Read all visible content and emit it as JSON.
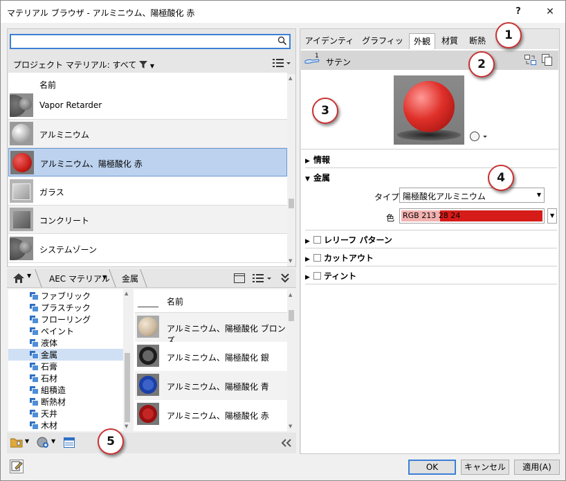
{
  "window": {
    "title": "マテリアル ブラウザ - アルミニウム、陽極酸化 赤",
    "help_label": "?",
    "close_label": "✕"
  },
  "search": {
    "value": "",
    "placeholder": ""
  },
  "project_filter": {
    "label": "プロジェクト マテリアル: すべて"
  },
  "project_list": {
    "header": "名前",
    "items": [
      {
        "label": "Vapor Retarder"
      },
      {
        "label": "アルミニウム"
      },
      {
        "label": "アルミニウム、陽極酸化 赤"
      },
      {
        "label": "ガラス"
      },
      {
        "label": "コンクリート"
      },
      {
        "label": "システムゾーン"
      }
    ]
  },
  "breadcrumb": {
    "items": [
      {
        "label": "AEC マテリアル"
      },
      {
        "label": "金属"
      }
    ]
  },
  "library_tree": {
    "items": [
      {
        "label": "ファブリック"
      },
      {
        "label": "プラスチック"
      },
      {
        "label": "フローリング"
      },
      {
        "label": "ペイント"
      },
      {
        "label": "液体"
      },
      {
        "label": "金属"
      },
      {
        "label": "石膏"
      },
      {
        "label": "石材"
      },
      {
        "label": "組積造"
      },
      {
        "label": "断熱材"
      },
      {
        "label": "天井"
      },
      {
        "label": "木材"
      }
    ]
  },
  "library_list": {
    "header": "名前",
    "items": [
      {
        "label": "アルミニウム、陽極酸化 ブロンズ"
      },
      {
        "label": "アルミニウム、陽極酸化 銀"
      },
      {
        "label": "アルミニウム、陽極酸化 青"
      },
      {
        "label": "アルミニウム、陽極酸化 赤"
      }
    ]
  },
  "tabs": [
    {
      "label": "アイデンティティ"
    },
    {
      "label": "グラフィックス"
    },
    {
      "label": "外観"
    },
    {
      "label": "材質"
    },
    {
      "label": "断熱"
    }
  ],
  "asset": {
    "count": "1",
    "name": "サテン"
  },
  "sections": {
    "info": "情報",
    "metal": "金属",
    "relief": "レリーフ パターン",
    "cutout": "カットアウト",
    "tint": "ティント"
  },
  "properties": {
    "type_label": "タイプ",
    "type_value": "陽極酸化アルミニウム",
    "color_label": "色",
    "color_value": "RGB 213 28 24"
  },
  "buttons": {
    "ok": "OK",
    "cancel": "キャンセル",
    "apply": "適用(A)"
  },
  "callouts": [
    "1",
    "2",
    "3",
    "4",
    "5"
  ],
  "colors": {
    "accent": "#3c7fd6",
    "selection": "#bcd2ee",
    "material_red": "#d51c18",
    "callout_border": "#c83232"
  },
  "icons": {
    "search": "search-icon",
    "filter": "filter-icon",
    "home": "home-icon",
    "view": "list-view-icon",
    "expand": "double-chevron-down-icon",
    "collapse": "double-chevron-left-icon"
  }
}
